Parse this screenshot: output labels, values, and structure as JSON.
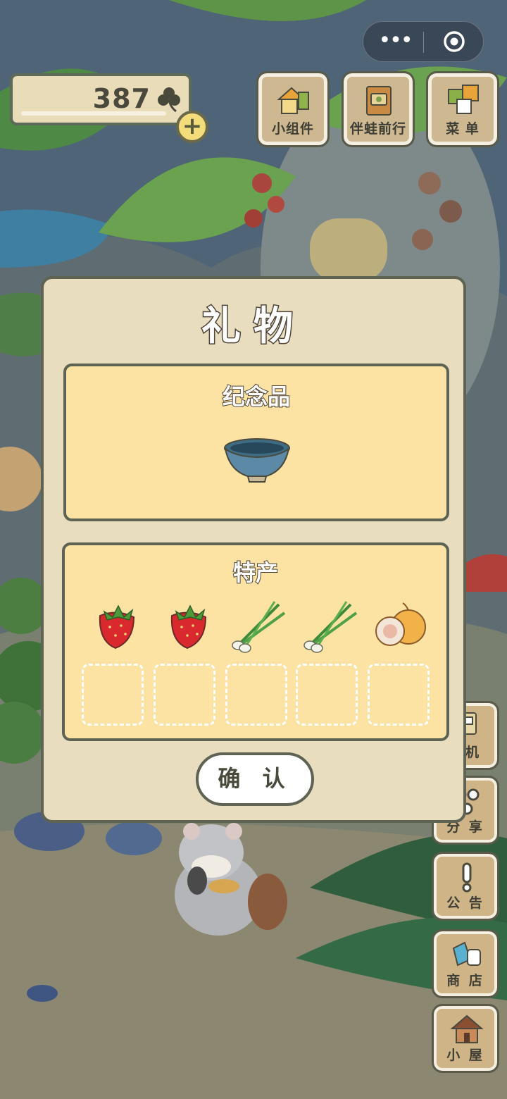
{
  "hud": {
    "clover_count": "387",
    "add_label": "+",
    "more_glyph": "•••"
  },
  "top_buttons": [
    {
      "label": "小组件",
      "icon": "widget-icon"
    },
    {
      "label": "伴蛙前行",
      "icon": "journey-book-icon"
    },
    {
      "label": "菜 单",
      "icon": "menu-cards-icon"
    }
  ],
  "side_buttons": [
    {
      "label": "摇机",
      "icon": "lottery-machine-icon"
    },
    {
      "label": "分 享",
      "icon": "share-icon"
    },
    {
      "label": "公 告",
      "icon": "notice-icon"
    },
    {
      "label": "商 店",
      "icon": "shop-bag-icon"
    },
    {
      "label": "小 屋",
      "icon": "house-icon"
    }
  ],
  "dialog": {
    "title": "礼物",
    "souvenir": {
      "title": "纪念品",
      "item": "tea-bowl-icon"
    },
    "specialty": {
      "title": "特产",
      "items": [
        "strawberry-icon",
        "strawberry-icon",
        "green-onion-icon",
        "green-onion-icon",
        "melon-icon"
      ],
      "empty_slots": 5
    },
    "confirm_label": "确 认"
  },
  "colors": {
    "panel": "#fde3a3",
    "dialog": "#e8ddbf",
    "outline": "#5e6354",
    "button_wood": "#cfb488"
  }
}
